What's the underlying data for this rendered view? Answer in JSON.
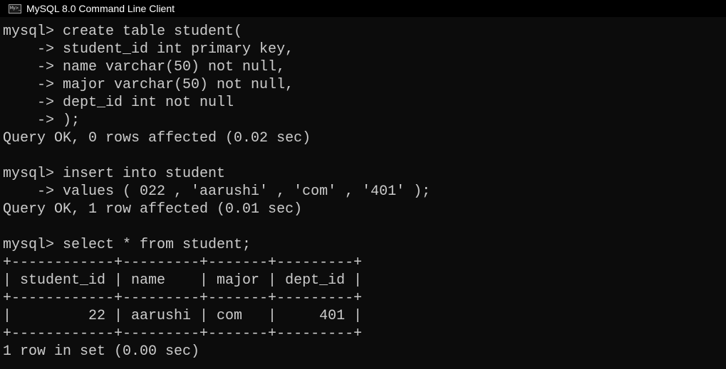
{
  "window": {
    "title": "MySQL 8.0 Command Line Client",
    "icon": "mysql-console-icon",
    "icon_glyph": "My>_"
  },
  "console": {
    "lines": [
      "mysql> create table student(",
      "    -> student_id int primary key,",
      "    -> name varchar(50) not null,",
      "    -> major varchar(50) not null,",
      "    -> dept_id int not null",
      "    -> );",
      "Query OK, 0 rows affected (0.02 sec)",
      "",
      "mysql> insert into student",
      "    -> values ( 022 , 'aarushi' , 'com' , '401' );",
      "Query OK, 1 row affected (0.01 sec)",
      "",
      "mysql> select * from student;",
      "+------------+---------+-------+---------+",
      "| student_id | name    | major | dept_id |",
      "+------------+---------+-------+---------+",
      "|         22 | aarushi | com   |     401 |",
      "+------------+---------+-------+---------+",
      "1 row in set (0.00 sec)"
    ]
  },
  "colors": {
    "background": "#0c0c0c",
    "text": "#cccccc",
    "titlebar": "#000000"
  }
}
